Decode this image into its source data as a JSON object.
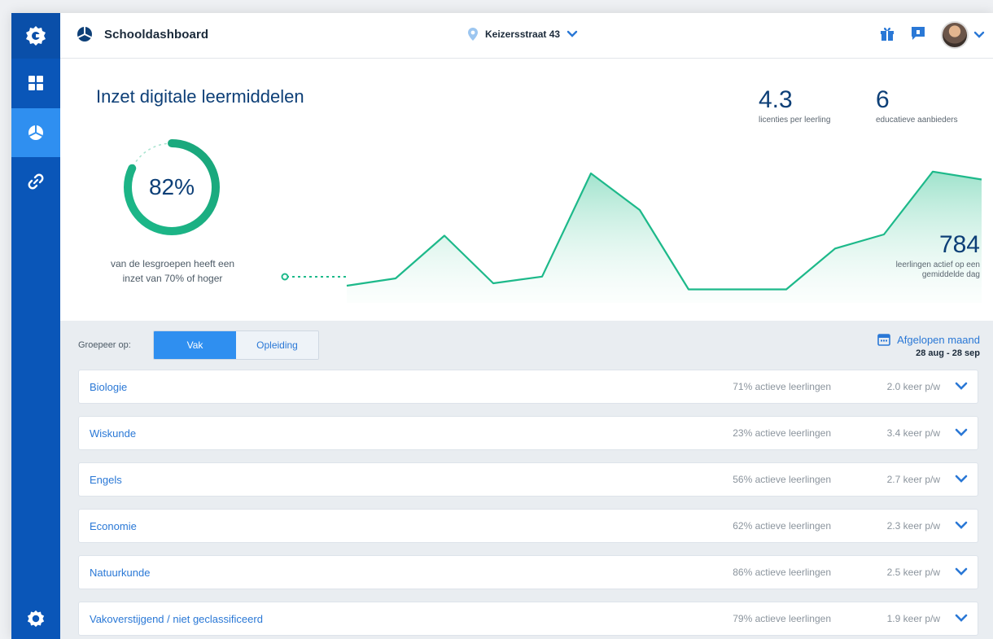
{
  "app": {
    "title": "Schooldashboard"
  },
  "location": {
    "label": "Keizersstraat 43"
  },
  "sidebar": {
    "items": [
      {
        "icon": "grid-icon"
      },
      {
        "icon": "pie-chart-icon",
        "active": true
      },
      {
        "icon": "link-icon"
      }
    ],
    "bottom_icon": "gear-icon"
  },
  "hero": {
    "title": "Inzet digitale leermiddelen",
    "donut_value": "82%",
    "donut_fraction": 0.82,
    "donut_caption_line1": "van de lesgroepen heeft een",
    "donut_caption_line2": "inzet van 70% of hoger",
    "stat_licenses_value": "4.3",
    "stat_licenses_label": "licenties per leerling",
    "stat_providers_value": "6",
    "stat_providers_label": "educatieve aanbieders",
    "stat_active_value": "784",
    "stat_active_label_line1": "leerlingen actief op een",
    "stat_active_label_line2": "gemiddelde dag"
  },
  "chart_data": {
    "type": "area",
    "title": "",
    "xlabel": "",
    "ylabel": "",
    "values": [
      28,
      40,
      110,
      32,
      43,
      212,
      152,
      22,
      22,
      22,
      89,
      112,
      215,
      202
    ],
    "ylim": [
      0,
      240
    ],
    "grid": false,
    "color": "#1db98a"
  },
  "filter": {
    "group_label": "Groepeer op:",
    "options": [
      "Vak",
      "Opleiding"
    ],
    "selected": "Vak",
    "period_label": "Afgelopen maand",
    "period_range": "28 aug - 28 sep"
  },
  "subjects": [
    {
      "name": "Biologie",
      "active": "71% actieve leerlingen",
      "freq": "2.0 keer p/w"
    },
    {
      "name": "Wiskunde",
      "active": "23% actieve leerlingen",
      "freq": "3.4 keer p/w"
    },
    {
      "name": "Engels",
      "active": "56% actieve leerlingen",
      "freq": "2.7 keer p/w"
    },
    {
      "name": "Economie",
      "active": "62% actieve leerlingen",
      "freq": "2.3 keer p/w"
    },
    {
      "name": "Natuurkunde",
      "active": "86% actieve leerlingen",
      "freq": "2.5 keer p/w"
    },
    {
      "name": "Vakoverstijgend / niet geclassificeerd",
      "active": "79% actieve leerlingen",
      "freq": "1.9 keer p/w"
    }
  ],
  "colors": {
    "sidebar": "#0a56b8",
    "sidebar_active": "#2f8ff0",
    "accent": "#2a78d6",
    "teal": "#1db98a",
    "navy": "#0d3f77"
  }
}
